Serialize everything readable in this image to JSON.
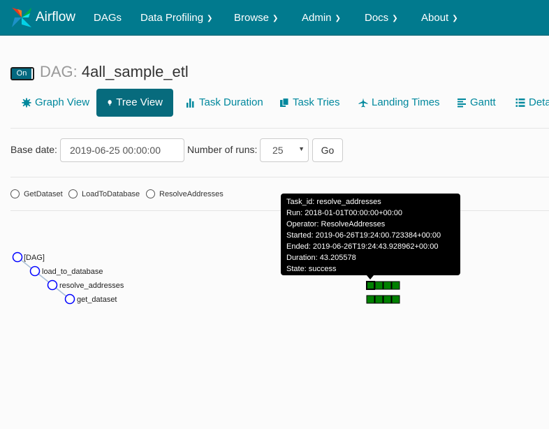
{
  "navbar": {
    "brand": "Airflow",
    "items": [
      {
        "label": "DAGs",
        "dropdown": false
      },
      {
        "label": "Data Profiling",
        "dropdown": true
      },
      {
        "label": "Browse",
        "dropdown": true
      },
      {
        "label": "Admin",
        "dropdown": true
      },
      {
        "label": "Docs",
        "dropdown": true
      },
      {
        "label": "About",
        "dropdown": true
      }
    ]
  },
  "dag": {
    "toggle_label": "On",
    "prefix": "DAG:",
    "name": "4all_sample_etl"
  },
  "tabs": [
    {
      "label": "Graph View",
      "icon": "asterisk-icon",
      "active": false
    },
    {
      "label": "Tree View",
      "icon": "tree-icon",
      "active": true
    },
    {
      "label": "Task Duration",
      "icon": "bar-chart-icon",
      "active": false
    },
    {
      "label": "Task Tries",
      "icon": "duplicate-icon",
      "active": false
    },
    {
      "label": "Landing Times",
      "icon": "plane-icon",
      "active": false
    },
    {
      "label": "Gantt",
      "icon": "align-left-icon",
      "active": false
    },
    {
      "label": "Deta",
      "icon": "list-icon",
      "active": false
    }
  ],
  "form": {
    "base_date_label": "Base date:",
    "base_date_value": "2019-06-25 00:00:00",
    "num_runs_label": "Number of runs:",
    "num_runs_value": "25",
    "go_label": "Go"
  },
  "legend": [
    "GetDataset",
    "LoadToDatabase",
    "ResolveAddresses"
  ],
  "tree": {
    "nodes": [
      "[DAG]",
      "load_to_database",
      "resolve_addresses",
      "get_dataset"
    ]
  },
  "tooltip": {
    "lines": [
      "Task_id: resolve_addresses",
      "Run: 2018-01-01T00:00:00+00:00",
      "Operator: ResolveAddresses",
      "Started: 2019-06-26T19:24:00.723384+00:00",
      "Ended: 2019-06-26T19:24:43.928962+00:00",
      "Duration: 43.205578",
      "State: success"
    ]
  },
  "colors": {
    "navbar": "#017a8e",
    "tab_text": "#00889d",
    "active_tab": "#076b7d",
    "success": "#008000",
    "node_stroke": "#0000ff"
  }
}
